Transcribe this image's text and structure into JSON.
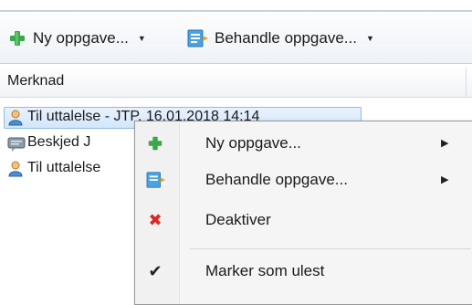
{
  "toolbar": {
    "new_task_label": "Ny oppgave...",
    "process_task_label": "Behandle oppgave...",
    "dropdown_arrow": "▼"
  },
  "table": {
    "header": "Merknad",
    "rows": [
      {
        "text": "Til uttalelse - JTP, 16.01.2018 14:14",
        "icon": "person-icon",
        "selected": true
      },
      {
        "text": "Beskjed J",
        "icon": "message-icon",
        "selected": false
      },
      {
        "text": "Til uttalelse",
        "icon": "person-icon",
        "selected": false
      }
    ]
  },
  "context_menu": {
    "items": [
      {
        "label": "Ny oppgave...",
        "icon": "green-plus-icon",
        "submenu": true
      },
      {
        "label": "Behandle oppgave...",
        "icon": "process-task-icon",
        "submenu": true
      },
      {
        "label": "Deaktiver",
        "icon": "red-x-icon",
        "submenu": false
      },
      {
        "label": "Marker som ulest",
        "icon": "checkmark-icon",
        "submenu": false
      }
    ],
    "submenu_arrow": "▶",
    "check_glyph": "✔",
    "x_glyph": "✖"
  },
  "colors": {
    "accent_green": "#3aa84a",
    "x_red": "#d9282a",
    "selection_border": "#8fbbea"
  }
}
